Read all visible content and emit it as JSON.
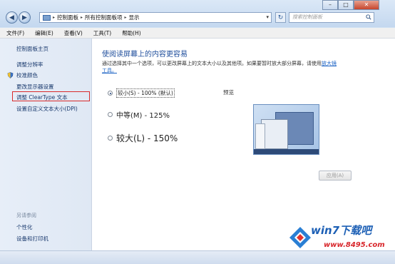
{
  "address": {
    "crumbs": [
      "控制面板",
      "所有控制面板项",
      "显示"
    ],
    "search_placeholder": "搜索控制面板"
  },
  "menu": [
    "文件(F)",
    "编辑(E)",
    "查看(V)",
    "工具(T)",
    "帮助(H)"
  ],
  "sidebar": {
    "items": [
      {
        "label": "控制面板主页"
      },
      {
        "label": "调整分辨率"
      },
      {
        "label": "校准颜色"
      },
      {
        "label": "更改显示器设置"
      },
      {
        "label": "调整 ClearType 文本"
      },
      {
        "label": "设置自定义文本大小(DPI)"
      }
    ],
    "see_also_title": "另请参阅",
    "see_also": [
      {
        "label": "个性化"
      },
      {
        "label": "设备和打印机"
      }
    ]
  },
  "main": {
    "title": "使阅读屏幕上的内容更容易",
    "desc_prefix": "通过选择其中一个选项，可以更改屏幕上的文本大小以及其他项。如果要暂时放大部分屏幕，请使用",
    "desc_link": "放大镜",
    "desc_suffix": "工具。",
    "options": [
      {
        "label": "较小(S) - 100% (默认)",
        "selected": true
      },
      {
        "label": "中等(M) - 125%",
        "selected": false
      },
      {
        "label": "较大(L) - 150%",
        "selected": false
      }
    ],
    "preview_label": "预览",
    "apply_label": "应用(A)"
  },
  "watermark": {
    "text": "win7下载吧",
    "url": "www.8495.com"
  },
  "colors": {
    "title_blue": "#1f4e9c",
    "link_blue": "#1c63c4",
    "highlight_red": "#d92b2b"
  }
}
